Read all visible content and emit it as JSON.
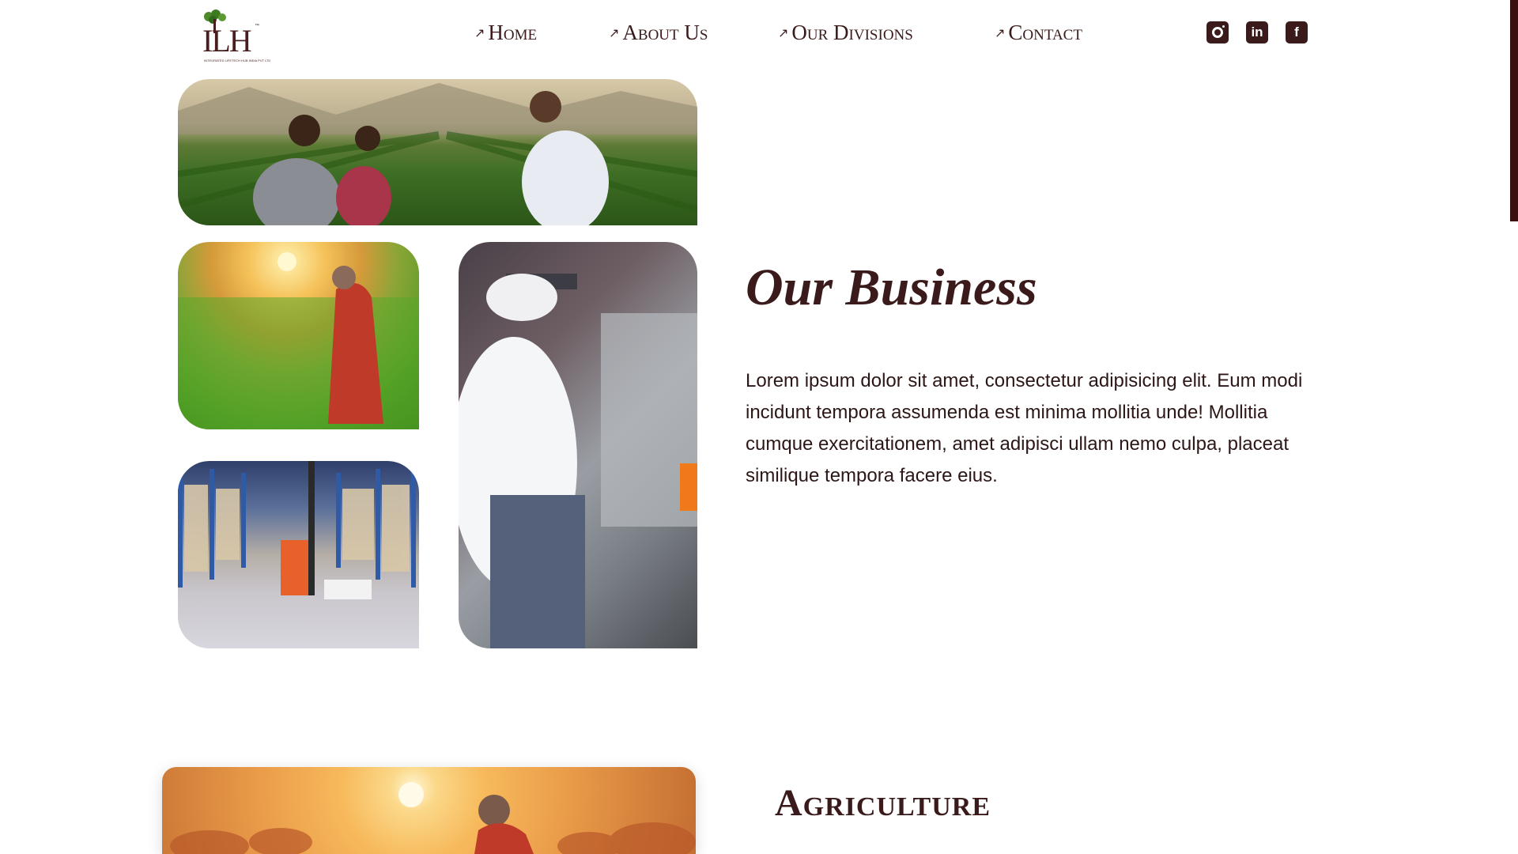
{
  "logo": {
    "text": "ILH",
    "tm": "™",
    "tagline": "INTEGRATED LIFETECH HUB INDIA PVT LTD"
  },
  "nav": {
    "items": [
      {
        "label": "Home"
      },
      {
        "label": "About Us"
      },
      {
        "label": "Our Divisions"
      },
      {
        "label": "Contact"
      }
    ],
    "arrow": "↗"
  },
  "social": {
    "icons": [
      "instagram-icon",
      "linkedin-icon",
      "facebook-icon"
    ],
    "linkedin_glyph": "in",
    "facebook_glyph": "f"
  },
  "business": {
    "title": "Our Business",
    "paragraph": "Lorem ipsum dolor sit amet, consectetur adipisicing elit. Eum modi incidunt tempora assumenda est minima mollitia unde! Mollitia cumque exercitationem, amet adipisci ullam nemo culpa, placeat similique tempora facere eius."
  },
  "agriculture": {
    "title": "Agriculture"
  },
  "colors": {
    "brand": "#3a1a1a",
    "accent": "#3a1010"
  }
}
